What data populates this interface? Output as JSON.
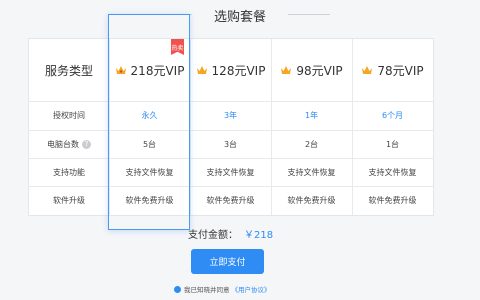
{
  "header": {
    "title": "选购套餐"
  },
  "table": {
    "type_label": "服务类型",
    "plans": [
      {
        "name": "218元VIP",
        "duration": "永久",
        "devices": "5台",
        "feature": "支持文件恢复",
        "upgrade": "软件免费升级"
      },
      {
        "name": "128元VIP",
        "duration": "3年",
        "devices": "3台",
        "feature": "支持文件恢复",
        "upgrade": "软件免费升级"
      },
      {
        "name": "98元VIP",
        "duration": "1年",
        "devices": "2台",
        "feature": "支持文件恢复",
        "upgrade": "软件免费升级"
      },
      {
        "name": "78元VIP",
        "duration": "6个月",
        "devices": "1台",
        "feature": "支持文件恢复",
        "upgrade": "软件免费升级"
      }
    ],
    "rows": {
      "duration_label": "授权时间",
      "devices_label": "电脑台数",
      "feature_label": "支持功能",
      "upgrade_label": "软件升级"
    },
    "hot_badge": "热卖",
    "question_icon": "?"
  },
  "payment": {
    "amount_label": "支付金额：",
    "amount_value": "￥218",
    "pay_button": "立即支付",
    "agree_text": "我已知晓并同意",
    "agreement_link": "《用户协议》"
  },
  "colors": {
    "accent": "#2f8cf5",
    "hot": "#f0524f",
    "crown": "#f5a623"
  }
}
